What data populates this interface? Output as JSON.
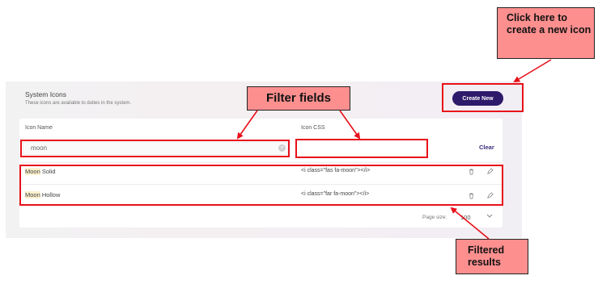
{
  "panel": {
    "title": "System Icons",
    "subtitle": "These icons are available to duties in the system.",
    "create_button": "Create New"
  },
  "filters": {
    "icon_name_header": "Icon Name",
    "icon_css_header": "Icon CSS",
    "icon_name_value": "moon",
    "icon_css_value": "",
    "clear_label": "Clear"
  },
  "rows": [
    {
      "highlight": "Moon",
      "rest": " Solid",
      "css": "<i class=\"fas fa-moon\"></i>"
    },
    {
      "highlight": "Moon",
      "rest": " Hollow",
      "css": "<i class=\"far fa-moon\"></i>"
    }
  ],
  "footer": {
    "page_size_label": "Page size:",
    "page_size_value": "100"
  },
  "annotations": {
    "create_callout": "Click here to create a new icon",
    "filter_callout": "Filter fields",
    "results_callout": "Filtered results"
  },
  "colors": {
    "accent": "#2e1a6b",
    "annotation_red": "#e8101a",
    "callout_fill": "#fd8f8f",
    "match_highlight": "#fbf1cd"
  }
}
